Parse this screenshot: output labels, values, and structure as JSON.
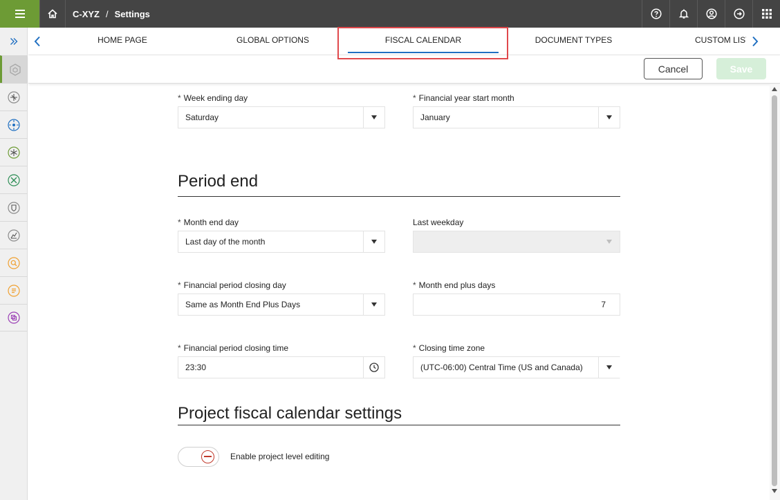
{
  "header": {
    "breadcrumb_app": "C-XYZ",
    "breadcrumb_sep": "/",
    "breadcrumb_page": "Settings"
  },
  "tabs": {
    "items": [
      {
        "label": "HOME PAGE"
      },
      {
        "label": "GLOBAL OPTIONS"
      },
      {
        "label": "FISCAL CALENDAR"
      },
      {
        "label": "DOCUMENT TYPES"
      },
      {
        "label": "CUSTOM LIST"
      }
    ],
    "active": "FISCAL CALENDAR"
  },
  "actions": {
    "cancel_label": "Cancel",
    "save_label": "Save"
  },
  "fiscal": {
    "week_ending_day": {
      "label": "Week ending day",
      "value": "Saturday",
      "required": "*"
    },
    "financial_year_start_month": {
      "label": "Financial year start month",
      "value": "January",
      "required": "*"
    }
  },
  "period_end": {
    "title": "Period end",
    "month_end_day": {
      "label": "Month end day",
      "value": "Last day of the month",
      "required": "*"
    },
    "last_weekday": {
      "label": "Last weekday",
      "value": ""
    },
    "financial_period_closing_day": {
      "label": "Financial period closing day",
      "value": "Same as Month End Plus Days",
      "required": "*"
    },
    "month_end_plus_days": {
      "label": "Month end plus days",
      "value": "7",
      "required": "*"
    },
    "financial_period_closing_time": {
      "label": "Financial period closing time",
      "value": "23:30",
      "required": "*"
    },
    "closing_time_zone": {
      "label": "Closing time zone",
      "value": "(UTC-06:00) Central Time (US and Canada)",
      "required": "*"
    }
  },
  "project": {
    "title": "Project fiscal calendar settings",
    "toggle_label": "Enable project level editing",
    "toggle_on": false
  },
  "colors": {
    "topbar": "#444444",
    "menu_accent": "#6d9b35",
    "tab_underline": "#1f6fc1",
    "tab_highlight_box": "#e0484b",
    "save_disabled": "#d6efd9"
  }
}
